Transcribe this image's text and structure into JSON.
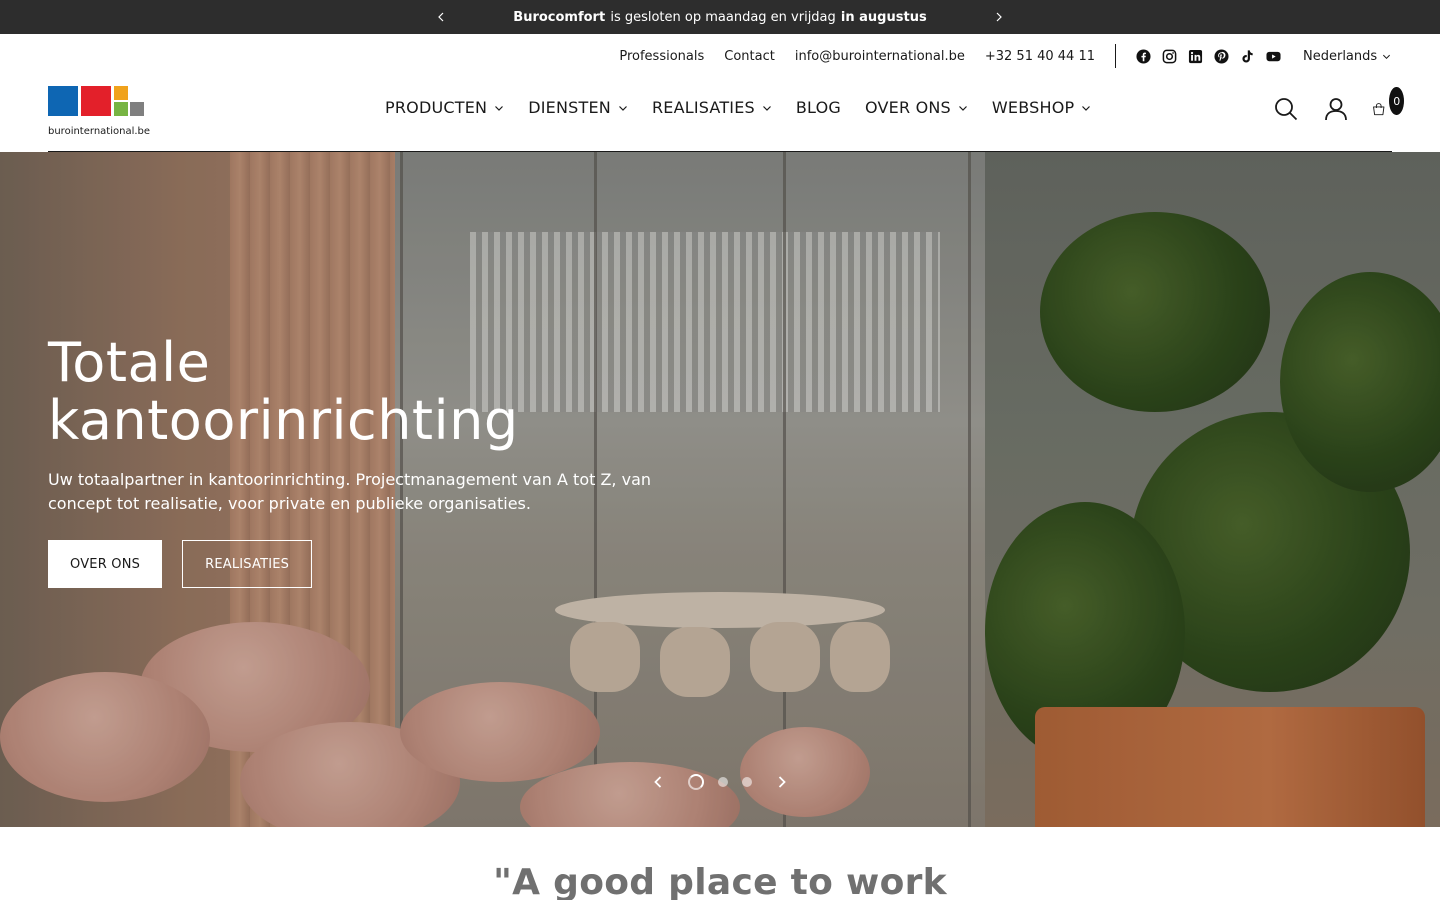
{
  "announcement": {
    "bold_start": "Burocomfort",
    "middle": "is gesloten op maandag en vrijdag",
    "bold_end": "in augustus"
  },
  "utility": {
    "links": [
      "Professionals",
      "Contact",
      "info@burointernational.be",
      "+32 51 40 44 11"
    ],
    "social_icons": [
      "facebook-icon",
      "instagram-icon",
      "linkedin-icon",
      "pinterest-icon",
      "tiktok-icon",
      "youtube-icon"
    ],
    "language": "Nederlands"
  },
  "header": {
    "logo_text": "burointernational.be",
    "logo_colors": [
      "#0e66b3",
      "#e3202a",
      "#f0a21c",
      "#77b443",
      "#7f7f7f"
    ],
    "nav": [
      {
        "label": "PRODUCTEN",
        "dropdown": true
      },
      {
        "label": "DIENSTEN",
        "dropdown": true
      },
      {
        "label": "REALISATIES",
        "dropdown": true
      },
      {
        "label": "BLOG",
        "dropdown": false
      },
      {
        "label": "OVER ONS",
        "dropdown": true
      },
      {
        "label": "WEBSHOP",
        "dropdown": true
      }
    ],
    "cart_count": "0"
  },
  "hero": {
    "title": "Totale kantoorinrichting",
    "subtitle": "Uw totaalpartner in kantoorinrichting. Projectmanagement van A tot Z, van concept tot realisatie, voor private en publieke organisaties.",
    "button_primary": "OVER ONS",
    "button_secondary": "REALISATIES",
    "slides_total": 3,
    "active_slide": 1
  },
  "quote": "\"A good place to work"
}
